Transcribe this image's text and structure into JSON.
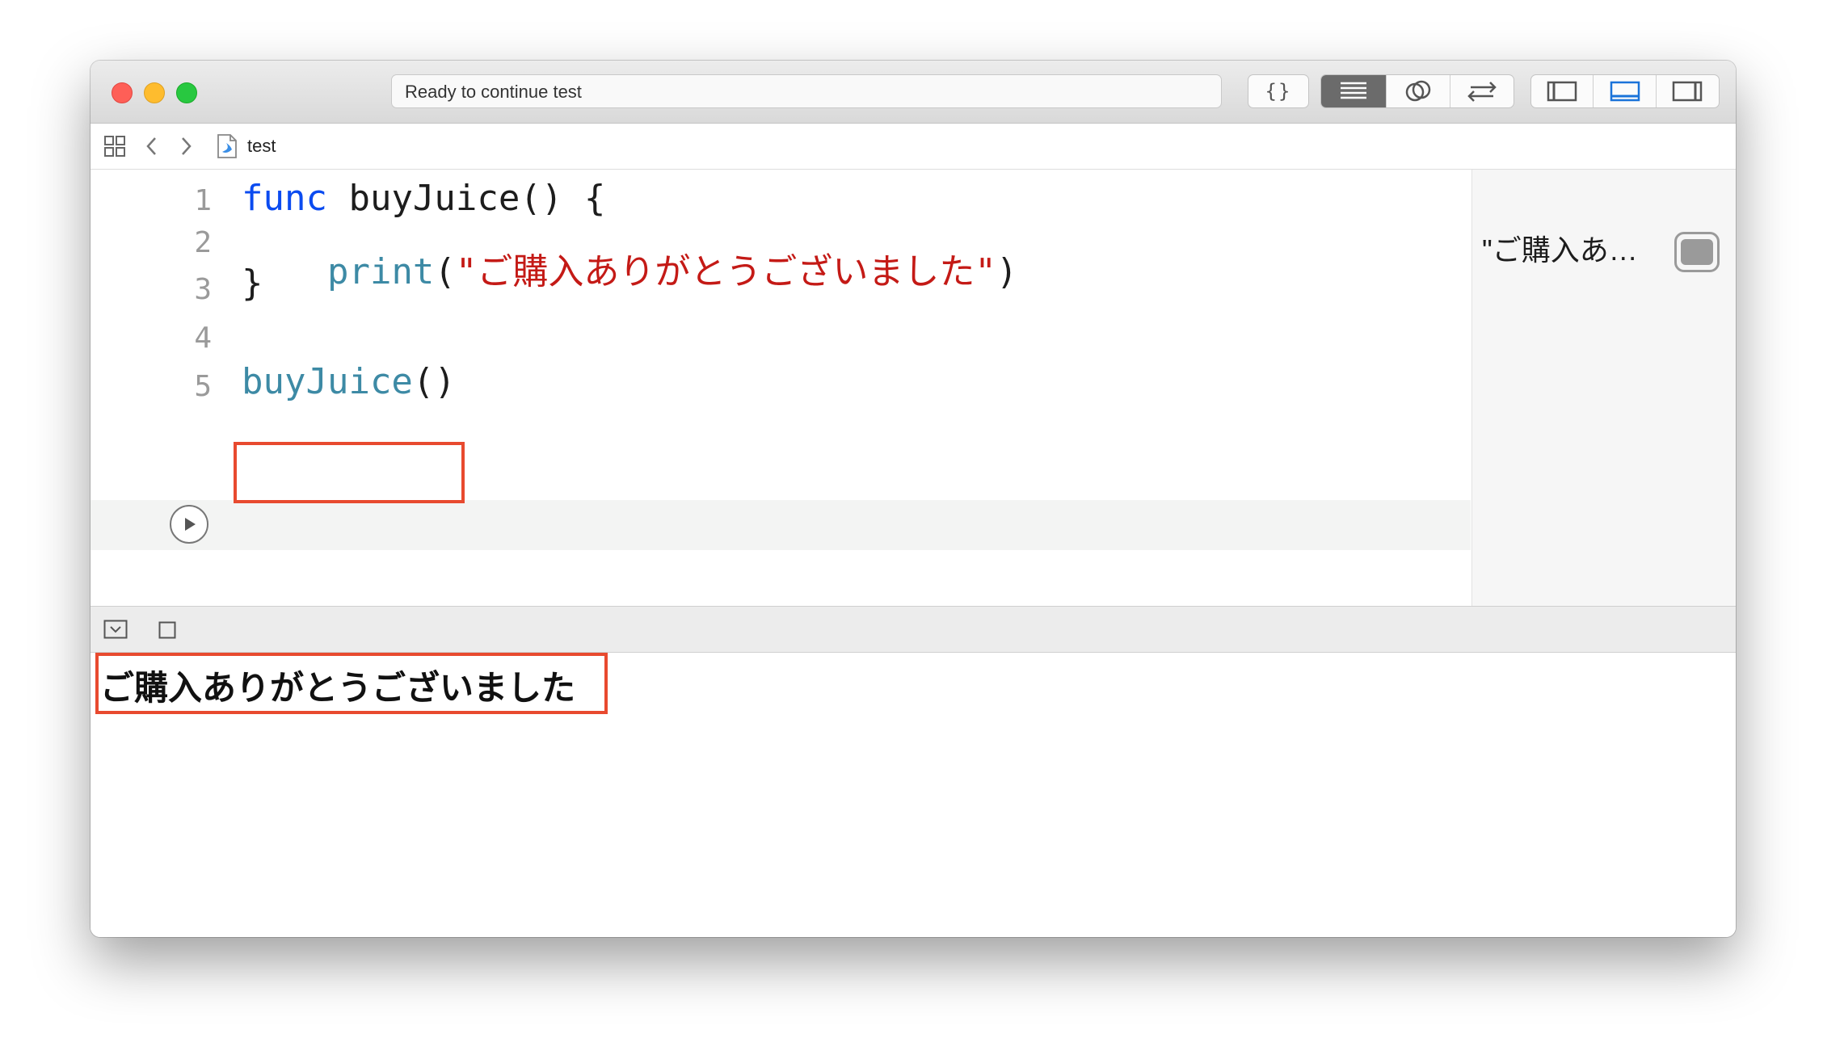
{
  "window": {
    "status_text": "Ready to continue test",
    "toolbar": {
      "code_snippet_label": "{}",
      "colors": {
        "active_segment": "#6b6b6b",
        "bottom_panel_active": "#1a73d9"
      }
    }
  },
  "pathbar": {
    "file_name": "test"
  },
  "editor": {
    "line_numbers": [
      "1",
      "2",
      "3",
      "4",
      "5"
    ],
    "lines": {
      "l1_keyword": "func",
      "l1_rest": " buyJuice() {",
      "l2_indent": "    ",
      "l2_fn": "print",
      "l2_open": "(",
      "l2_string": "\"ご購入ありがとうございました\"",
      "l2_close": ")",
      "l3": "}",
      "l5_fn": "buyJuice",
      "l5_rest": "()"
    }
  },
  "results_sidebar": {
    "result_text": "\"ご購入あ…"
  },
  "console": {
    "output": "ご購入ありがとうございました"
  },
  "highlight_color": "#e84a2f"
}
